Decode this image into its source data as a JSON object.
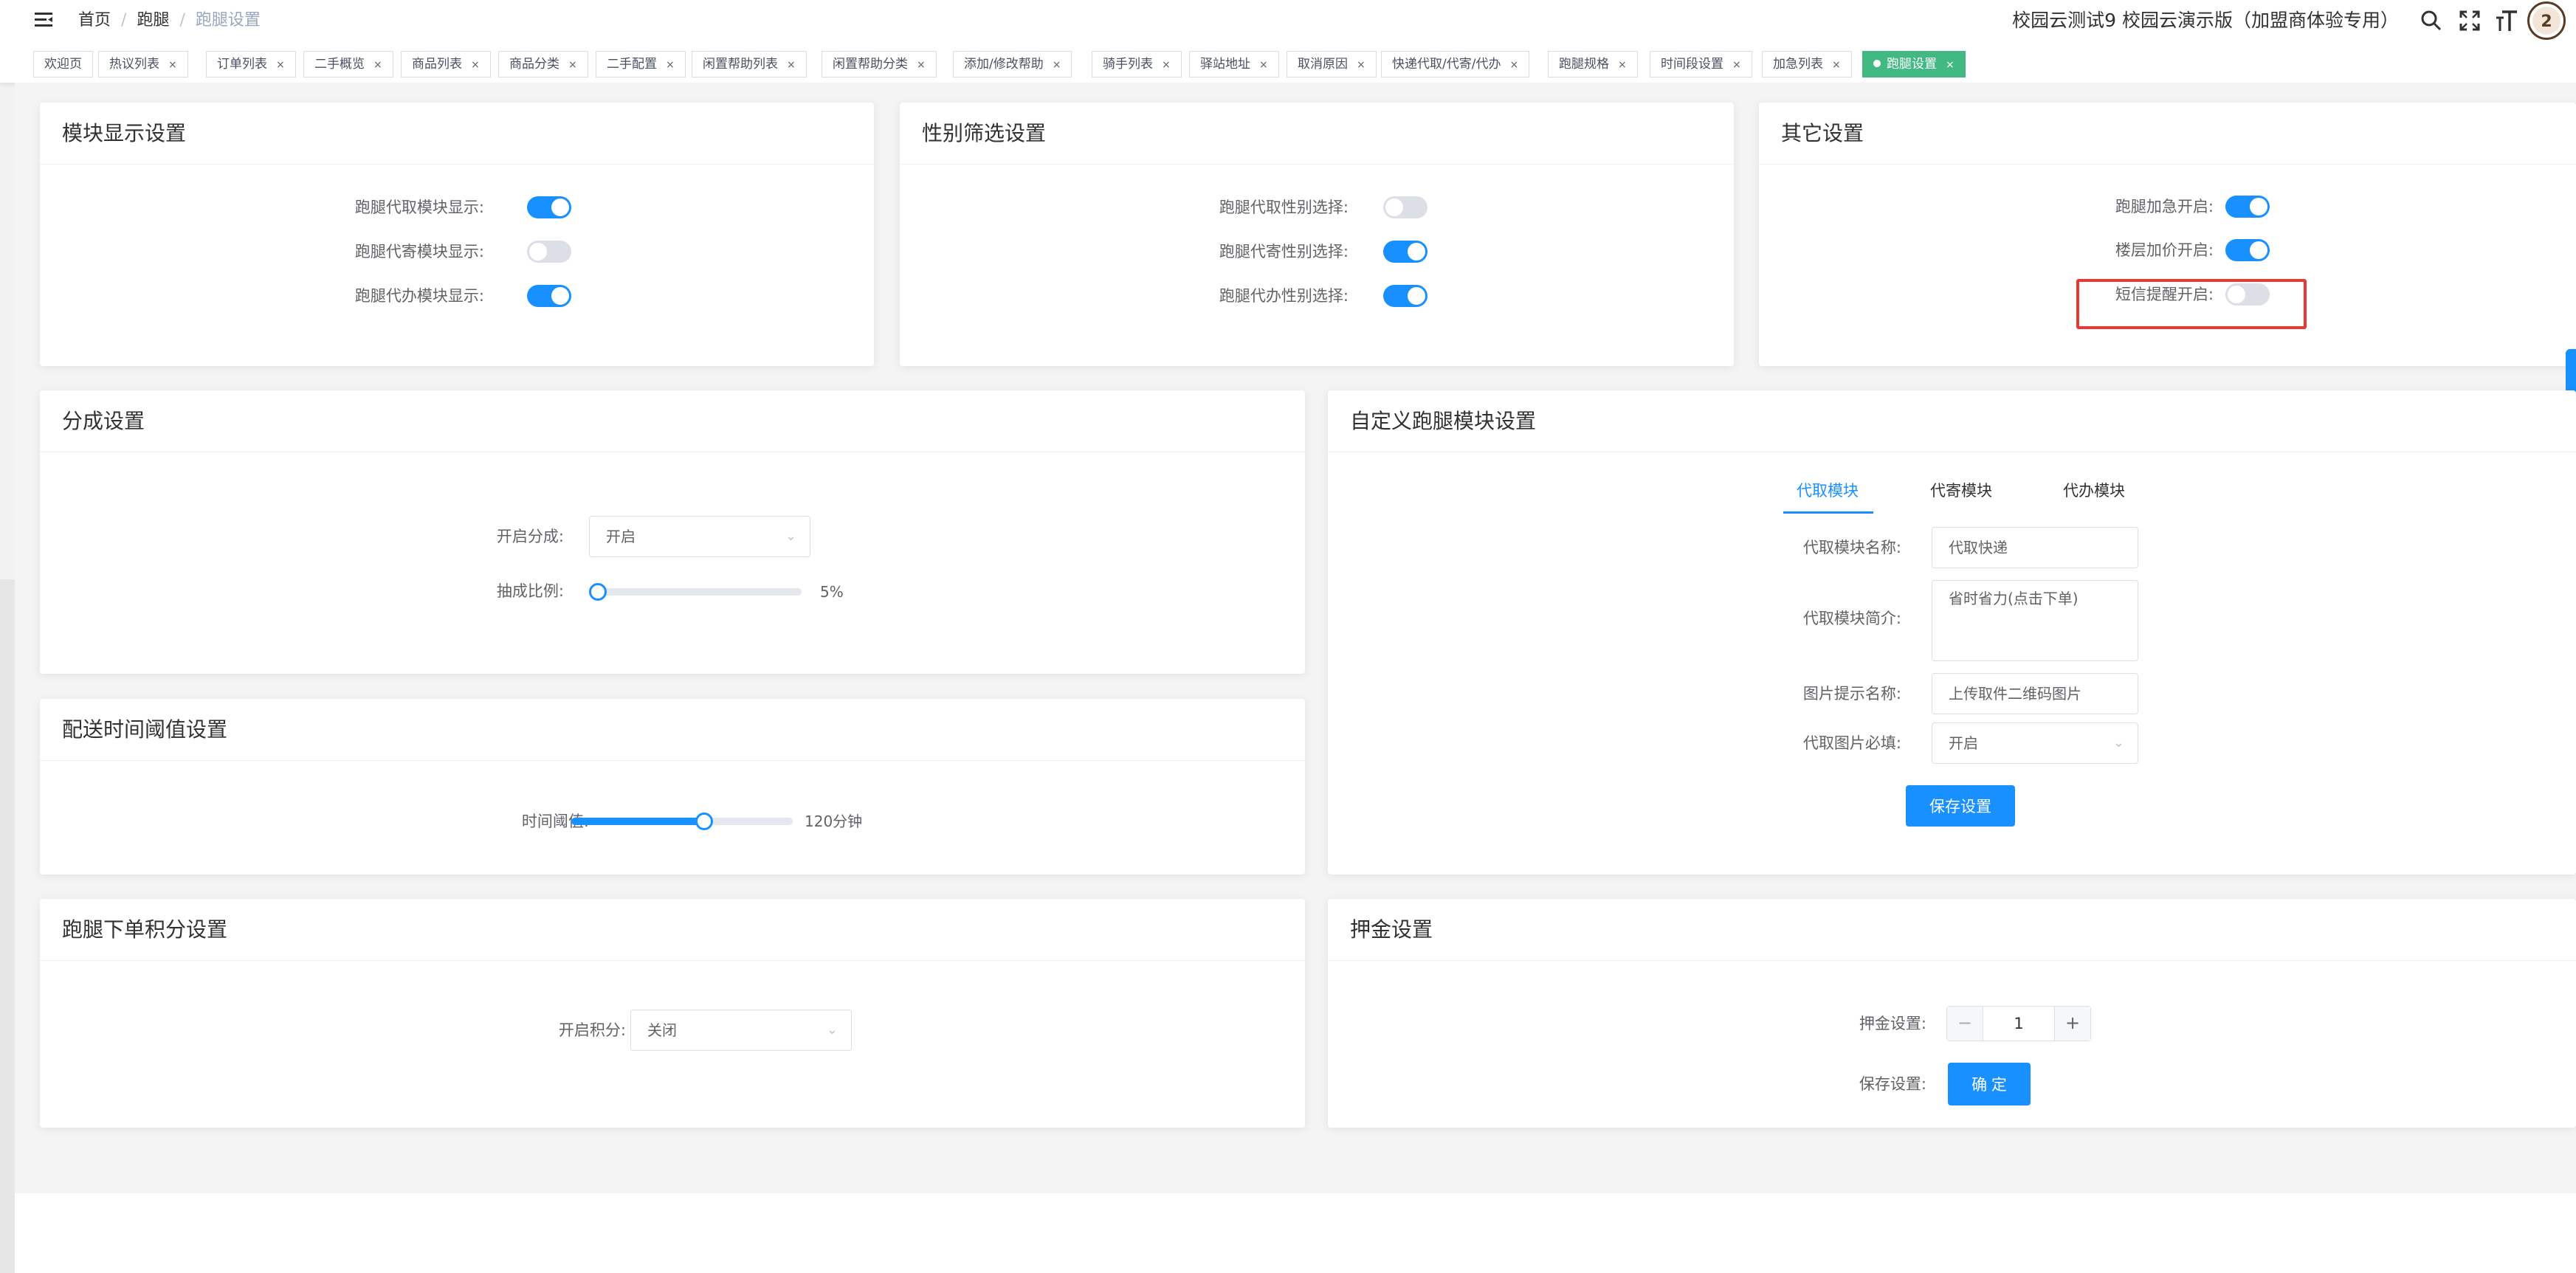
{
  "header": {
    "breadcrumb": [
      "首页",
      "跑腿",
      "跑腿设置"
    ],
    "title": "校园云测试9 校园云演示版（加盟商体验专用）",
    "icons": [
      "search-icon",
      "fullscreen-icon",
      "font-size-icon",
      "avatar"
    ]
  },
  "tags": [
    {
      "label": "欢迎页",
      "closable": false
    },
    {
      "label": "热议列表",
      "closable": true
    },
    {
      "label": "订单列表",
      "closable": true
    },
    {
      "label": "二手概览",
      "closable": true
    },
    {
      "label": "商品列表",
      "closable": true
    },
    {
      "label": "商品分类",
      "closable": true
    },
    {
      "label": "二手配置",
      "closable": true
    },
    {
      "label": "闲置帮助列表",
      "closable": true
    },
    {
      "label": "闲置帮助分类",
      "closable": true
    },
    {
      "label": "添加/修改帮助",
      "closable": true
    },
    {
      "label": "骑手列表",
      "closable": true
    },
    {
      "label": "驿站地址",
      "closable": true
    },
    {
      "label": "取消原因",
      "closable": true
    },
    {
      "label": "快递代取/代寄/代办",
      "closable": true
    },
    {
      "label": "跑腿规格",
      "closable": true
    },
    {
      "label": "时间段设置",
      "closable": true
    },
    {
      "label": "加急列表",
      "closable": true
    },
    {
      "label": "跑腿设置",
      "closable": true,
      "active": true
    }
  ],
  "module_display": {
    "title": "模块显示设置",
    "items": [
      {
        "label": "跑腿代取模块显示:",
        "on": true
      },
      {
        "label": "跑腿代寄模块显示:",
        "on": false
      },
      {
        "label": "跑腿代办模块显示:",
        "on": true
      }
    ]
  },
  "gender_filter": {
    "title": "性别筛选设置",
    "items": [
      {
        "label": "跑腿代取性别选择:",
        "on": false
      },
      {
        "label": "跑腿代寄性别选择:",
        "on": true
      },
      {
        "label": "跑腿代办性别选择:",
        "on": true
      }
    ]
  },
  "other": {
    "title": "其它设置",
    "items": [
      {
        "label": "跑腿加急开启:",
        "on": true
      },
      {
        "label": "楼层加价开启:",
        "on": true
      },
      {
        "label": "短信提醒开启:",
        "on": false
      }
    ]
  },
  "commission": {
    "title": "分成设置",
    "enable_label": "开启分成:",
    "enable_value": "开启",
    "ratio_label": "抽成比例:",
    "ratio_value": "5%",
    "ratio_fraction": 0.0
  },
  "delivery_time": {
    "title": "配送时间阈值设置",
    "label": "时间阈值:",
    "value": "120分钟",
    "fraction": 0.6
  },
  "points": {
    "title": "跑腿下单积分设置",
    "label": "开启积分:",
    "value": "关闭"
  },
  "custom_module": {
    "title": "自定义跑腿模块设置",
    "tabs": [
      "代取模块",
      "代寄模块",
      "代办模块"
    ],
    "active_tab": 0,
    "name_label": "代取模块名称:",
    "name_value": "代取快递",
    "intro_label": "代取模块简介:",
    "intro_value": "省时省力(点击下单)",
    "img_hint_label": "图片提示名称:",
    "img_hint_value": "上传取件二维码图片",
    "img_required_label": "代取图片必填:",
    "img_required_value": "开启",
    "save_label": "保存设置"
  },
  "deposit": {
    "title": "押金设置",
    "label": "押金设置:",
    "value": "1",
    "save_label": "保存设置:",
    "confirm_label": "确 定"
  }
}
